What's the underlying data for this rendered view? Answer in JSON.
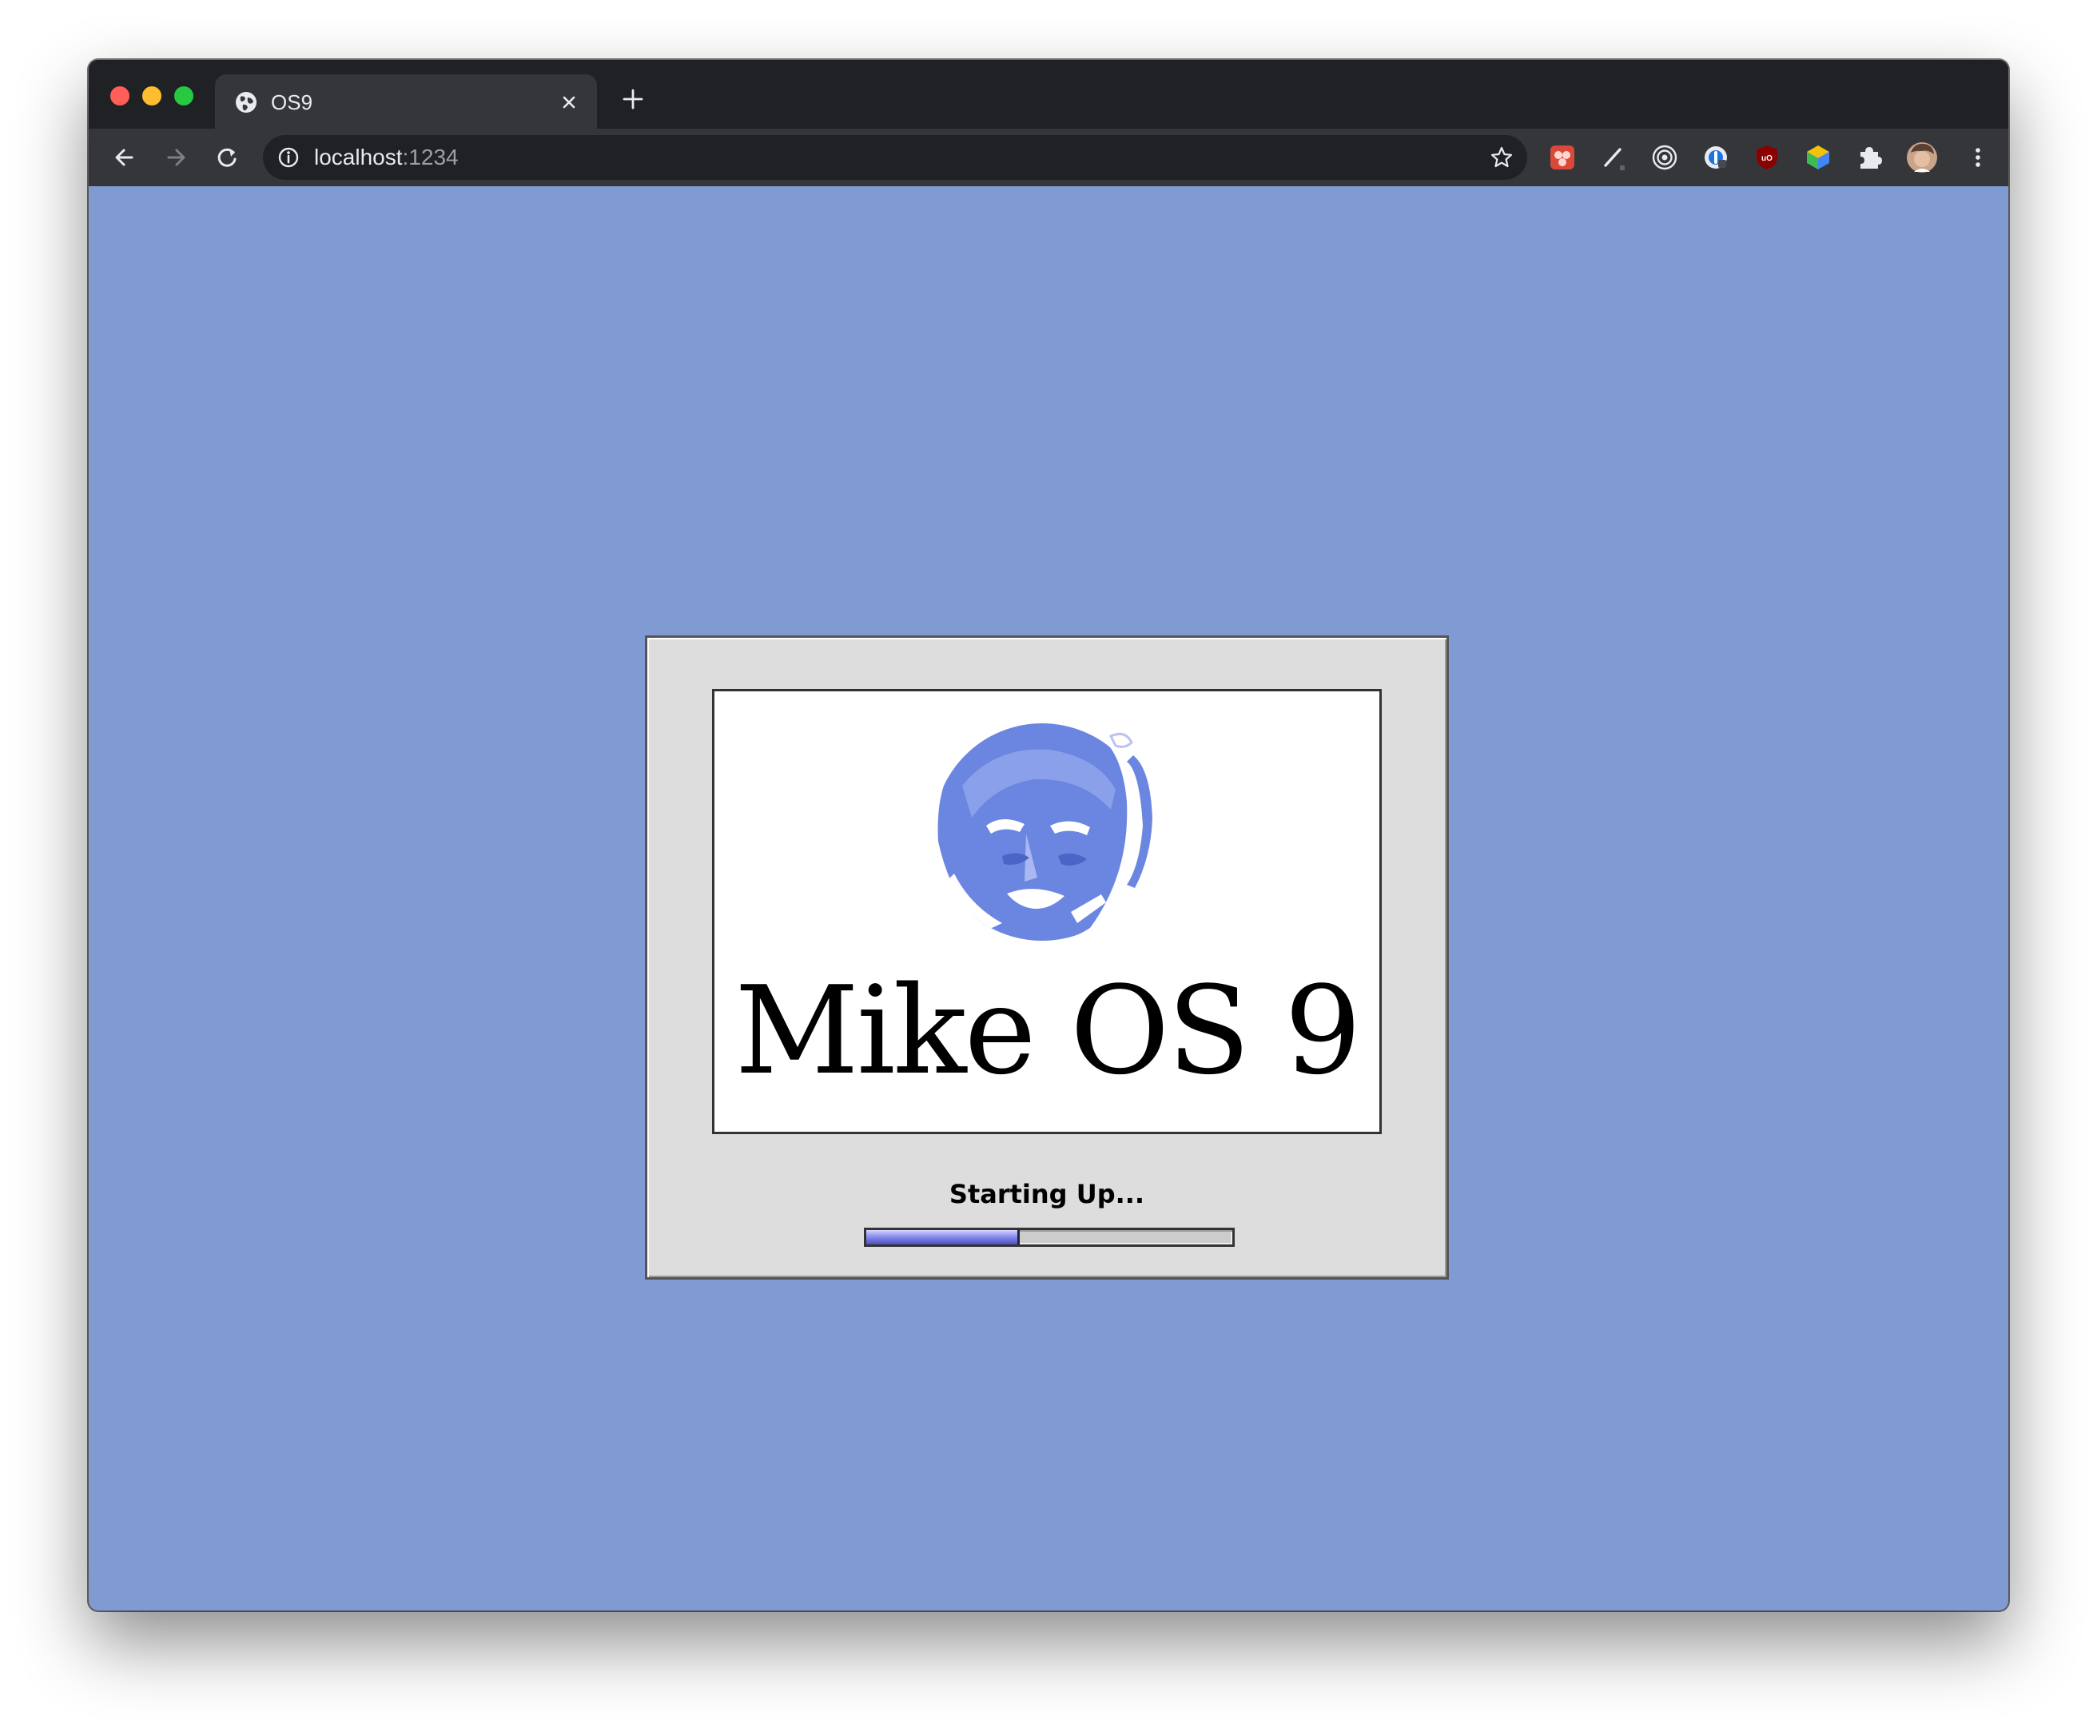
{
  "browser": {
    "tab": {
      "title": "OS9",
      "favicon": "globe-icon"
    },
    "address_bar": {
      "host": "localhost",
      "port": ":1234"
    },
    "extensions": [
      "tomato-extension-icon",
      "pen-extension-icon",
      "target-extension-icon",
      "password-extension-icon",
      "ublock-extension-icon",
      "cube-extension-icon",
      "puzzle-icon",
      "profile-avatar",
      "kebab-menu-icon"
    ]
  },
  "boot": {
    "title": "Mike OS 9",
    "status": "Starting Up...",
    "progress": 0.42
  },
  "colors": {
    "desktop": "#7f9bd2",
    "dialog": "#dddddd",
    "portrait": "#6b86e0",
    "progress": "#6c70dc"
  }
}
